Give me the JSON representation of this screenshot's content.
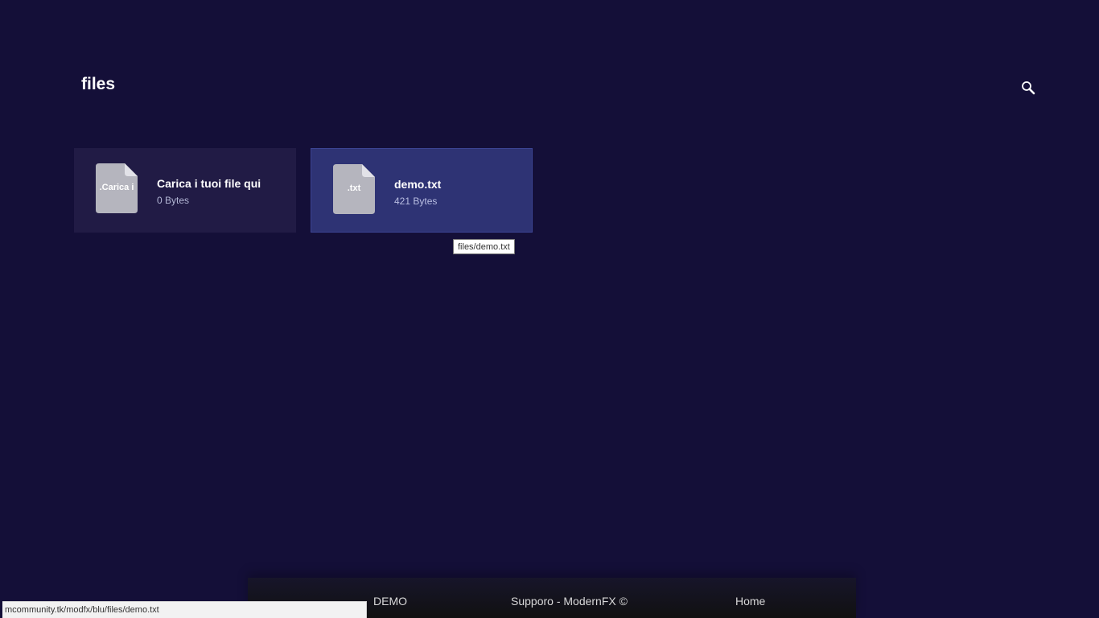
{
  "header": {
    "title": "files",
    "search_icon": "search-icon"
  },
  "files": [
    {
      "ext_label": ".Carica i",
      "name": "Carica i tuoi file qui",
      "size": "0 Bytes",
      "icon": "file-icon"
    },
    {
      "ext_label": ".txt",
      "name": "demo.txt",
      "size": "421 Bytes",
      "icon": "file-icon",
      "hovered": true
    }
  ],
  "tooltip": "files/demo.txt",
  "footer": {
    "demo_label": "DEMO",
    "credit": "Supporo - ModernFX ©",
    "home_label": "Home"
  },
  "status_url": "mcommunity.tk/modfx/blu/files/demo.txt",
  "colors": {
    "background": "#140f38",
    "card": "#211b45",
    "card_hover": "#2e3374",
    "file_icon": "#b5b5be"
  }
}
